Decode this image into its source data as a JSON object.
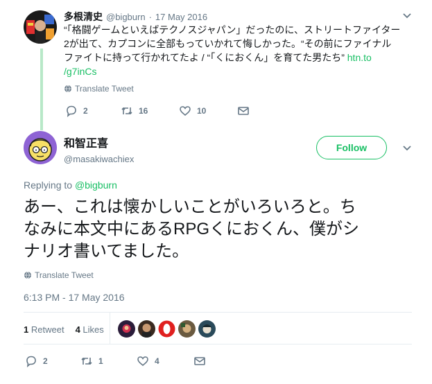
{
  "parent_tweet": {
    "name": "多根清史",
    "handle": "@bigburn",
    "separator": "·",
    "date": "17 May 2016",
    "text_line1": "“「格闘ゲームといえばテクノスジャパン」だったのに、ストリートファイター",
    "text_line2": "2が出て、カプコンに全部もっていかれて悔しかった。“その前にファイナル",
    "text_line3_prefix": "ファイトに持って行かれてたよ / “「くにおくん」を育てた男たち” ",
    "text_link_1": "htn.to",
    "text_link_2": "/g7inCs",
    "translate_label": "Translate Tweet",
    "reply_count": "2",
    "retweet_count": "16",
    "like_count": "10"
  },
  "main_tweet": {
    "name": "和智正喜",
    "handle": "@masakiwachiex",
    "follow_label": "Follow",
    "replying_prefix": "Replying to",
    "replying_handle": "@bigburn",
    "text_line1": "あー、これは懐かしいことがいろいろと。ち",
    "text_line2": "なみに本文中にあるRPGくにおくん、僕がシ",
    "text_line3": "ナリオ書いてました。",
    "translate_label": "Translate Tweet",
    "timestamp": "6:13 PM - 17 May 2016",
    "retweets_count": "1",
    "retweets_label": "Retweet",
    "likes_count": "4",
    "likes_label": "Likes",
    "reply_count": "2",
    "retweet_count": "1",
    "like_count": "4"
  },
  "colors": {
    "accent": "#17bf63",
    "link": "#1b95e0",
    "muted": "#657786"
  }
}
